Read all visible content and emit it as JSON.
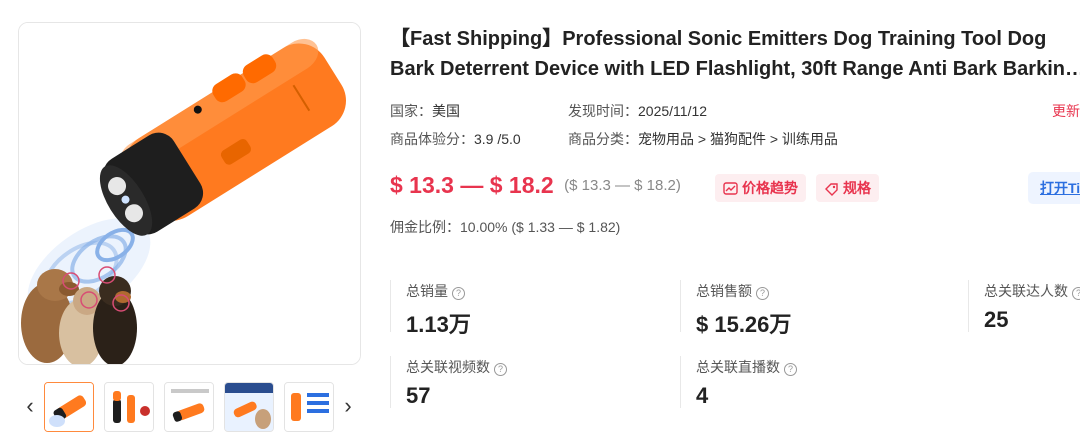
{
  "product": {
    "title_line1": "【Fast Shipping】Professional Sonic Emitters Dog Training Tool Dog",
    "title_line2": "Bark Deterrent Device with LED Flashlight, 30ft Range Anti Bark Barkin…"
  },
  "meta": {
    "country_label": "国家：",
    "country_value": "美国",
    "found_label": "发现时间：",
    "found_value": "2025/11/12",
    "experience_label": "商品体验分：",
    "experience_value": "3.9 /5.0",
    "category_label": "商品分类：",
    "category_value": "宠物用品 > 猫狗配件 > 训练用品",
    "update_link": "更新"
  },
  "price": {
    "range": "$ 13.3 — $ 18.2",
    "range_sub": "($ 13.3 — $ 18.2)",
    "trend_label": "价格趋势",
    "spec_label": "规格",
    "open_label": "打开Ti"
  },
  "commission": {
    "label": "佣金比例：",
    "value": "10.00% ($ 1.33 — $ 1.82)"
  },
  "stats": [
    {
      "label": "总销量",
      "value": "1.13万"
    },
    {
      "label": "总销售额",
      "value": "$ 15.26万"
    },
    {
      "label": "总关联达人数",
      "value": "25"
    },
    {
      "label": "总关联视频数",
      "value": "57"
    },
    {
      "label": "总关联直播数",
      "value": "4"
    }
  ],
  "icons": {
    "prev": "chevron-left-icon",
    "next": "chevron-right-icon",
    "trend": "chart-trend-icon",
    "tag": "tag-icon",
    "help": "question-circle-icon"
  },
  "colors": {
    "accent_red": "#e8344e",
    "accent_blue": "#2c6fe0",
    "device_orange": "#ff7a1f"
  },
  "thumb_strip": {
    "prev": "‹",
    "next": "›",
    "help_glyph": "?"
  }
}
